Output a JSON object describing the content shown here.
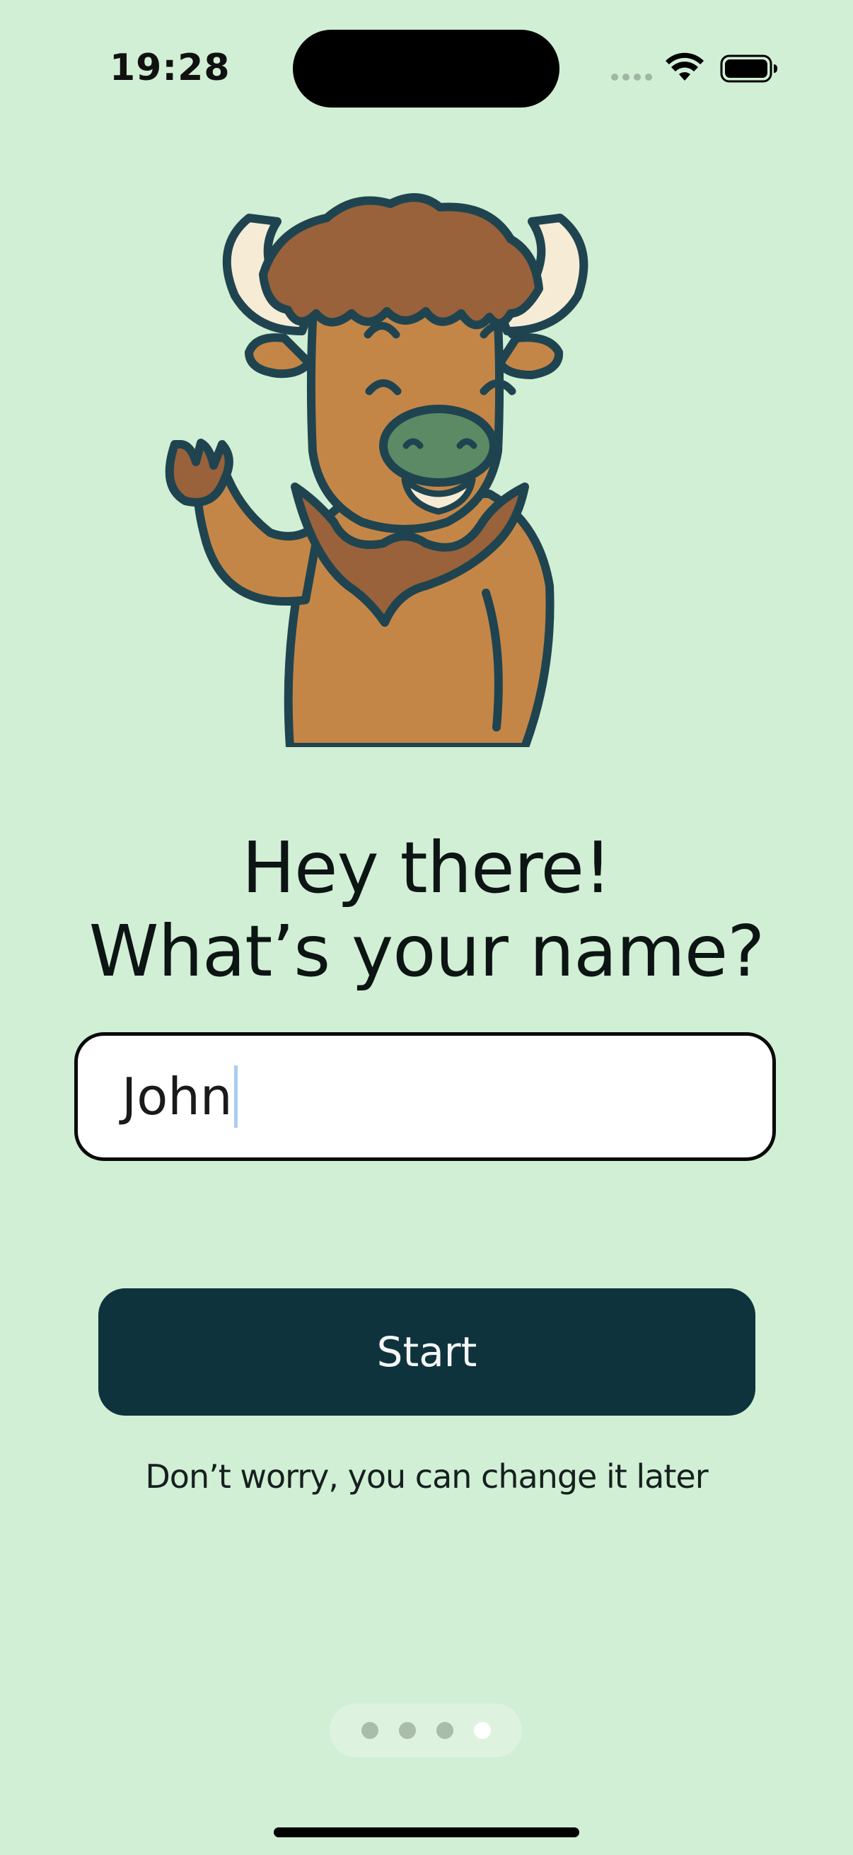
{
  "status_bar": {
    "time": "19:28"
  },
  "onboarding": {
    "heading_line1": "Hey there!",
    "heading_line2": "What’s your name?",
    "name_input": {
      "value": "John",
      "placeholder": ""
    },
    "start_button_label": "Start",
    "hint": "Don’t worry, you can change it later",
    "pagination": {
      "total_pages": 4,
      "current_page": 4
    }
  },
  "colors": {
    "background": "#d1efd4",
    "button": "#0f333d",
    "button_text": "#f4f7f6",
    "mascot_fur": "#c48647",
    "mascot_mane": "#99623a",
    "mascot_outline": "#1f4450",
    "mascot_nose": "#5b8a64",
    "mascot_horns": "#f6ecd6"
  },
  "icons": [
    "wifi-icon",
    "battery-icon",
    "bison-mascot"
  ]
}
